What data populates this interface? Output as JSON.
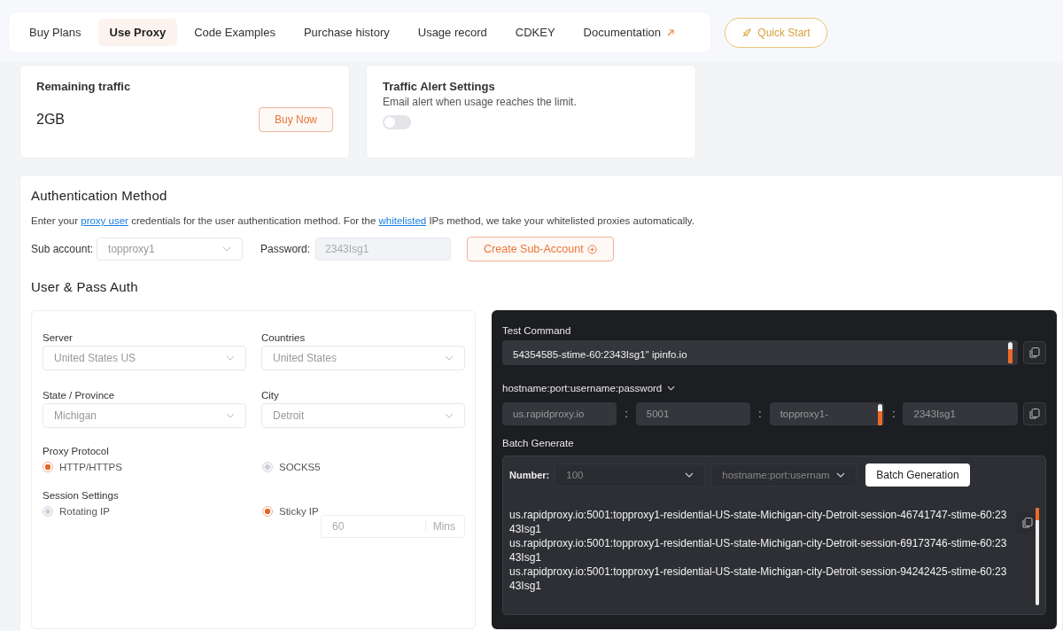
{
  "tabs": [
    {
      "label": "Buy Plans",
      "selected": false,
      "kind": "tab"
    },
    {
      "label": "Use Proxy",
      "selected": true,
      "kind": "tab"
    },
    {
      "label": "Code Examples",
      "selected": false,
      "kind": "tab"
    },
    {
      "label": "Purchase history",
      "selected": false,
      "kind": "tab"
    },
    {
      "label": "Usage record",
      "selected": false,
      "kind": "tab"
    },
    {
      "label": "CDKEY",
      "selected": false,
      "kind": "tab"
    },
    {
      "label": "Documentation",
      "selected": false,
      "kind": "external"
    }
  ],
  "quick_start": "Quick Start",
  "remaining": {
    "title": "Remaining traffic",
    "value": "2GB",
    "button": "Buy Now"
  },
  "alert": {
    "title": "Traffic Alert Settings",
    "description": "Email alert when usage reaches the limit.",
    "toggle": {
      "on": false
    }
  },
  "auth": {
    "title": "Authentication Method",
    "description": [
      {
        "text": "Enter your ",
        "link": false
      },
      {
        "text": "proxy user",
        "link": true
      },
      {
        "text": " credentials for the user authentication method. For the ",
        "link": false
      },
      {
        "text": "whitelisted",
        "link": true
      },
      {
        "text": " IPs method, we take your whitelisted proxies automatically.",
        "link": false
      }
    ],
    "sub_account": {
      "label": "Sub account:",
      "value": "topproxy1"
    },
    "password": {
      "label": "Password:",
      "value": "2343Isg1"
    },
    "create_button": "Create Sub-Account"
  },
  "user_pass": {
    "title": "User & Pass Auth",
    "selects": [
      {
        "label": "Server",
        "value": "United States US"
      },
      {
        "label": "Countries",
        "value": "United States"
      },
      {
        "label": "State / Province",
        "value": "Michigan"
      },
      {
        "label": "City",
        "value": "Detroit"
      }
    ],
    "protocol": {
      "label": "Proxy Protocol",
      "options": [
        {
          "label": "HTTP/HTTPS",
          "selected": true
        },
        {
          "label": "SOCKS5",
          "selected": false
        }
      ]
    },
    "session": {
      "label": "Session Settings",
      "options": [
        {
          "label": "Rotating IP",
          "selected": false
        },
        {
          "label": "Sticky IP",
          "selected": true
        }
      ],
      "sticky_value": "60",
      "unit": "Mins"
    }
  },
  "test": {
    "title": "Test Command",
    "command": "54354585-stime-60:2343Isg1\" ipinfo.io",
    "format": "hostname:port:username:password",
    "parts": [
      "us.rapidproxy.io",
      "5001",
      "topproxy1-",
      "2343Isg1"
    ],
    "separator": ":",
    "batch": {
      "title": "Batch Generate",
      "number_label": "Number:",
      "number": "100",
      "format": "hostname:port:usernam",
      "button": "Batch Generation",
      "lines": [
        "us.rapidproxy.io:5001:topproxy1-residential-US-state-Michigan-city-Detroit-session-46741747-stime-60:2343Isg1",
        "us.rapidproxy.io:5001:topproxy1-residential-US-state-Michigan-city-Detroit-session-69173746-stime-60:2343Isg1",
        "us.rapidproxy.io:5001:topproxy1-residential-US-state-Michigan-city-Detroit-session-94242425-stime-60:2343Isg1"
      ]
    }
  }
}
